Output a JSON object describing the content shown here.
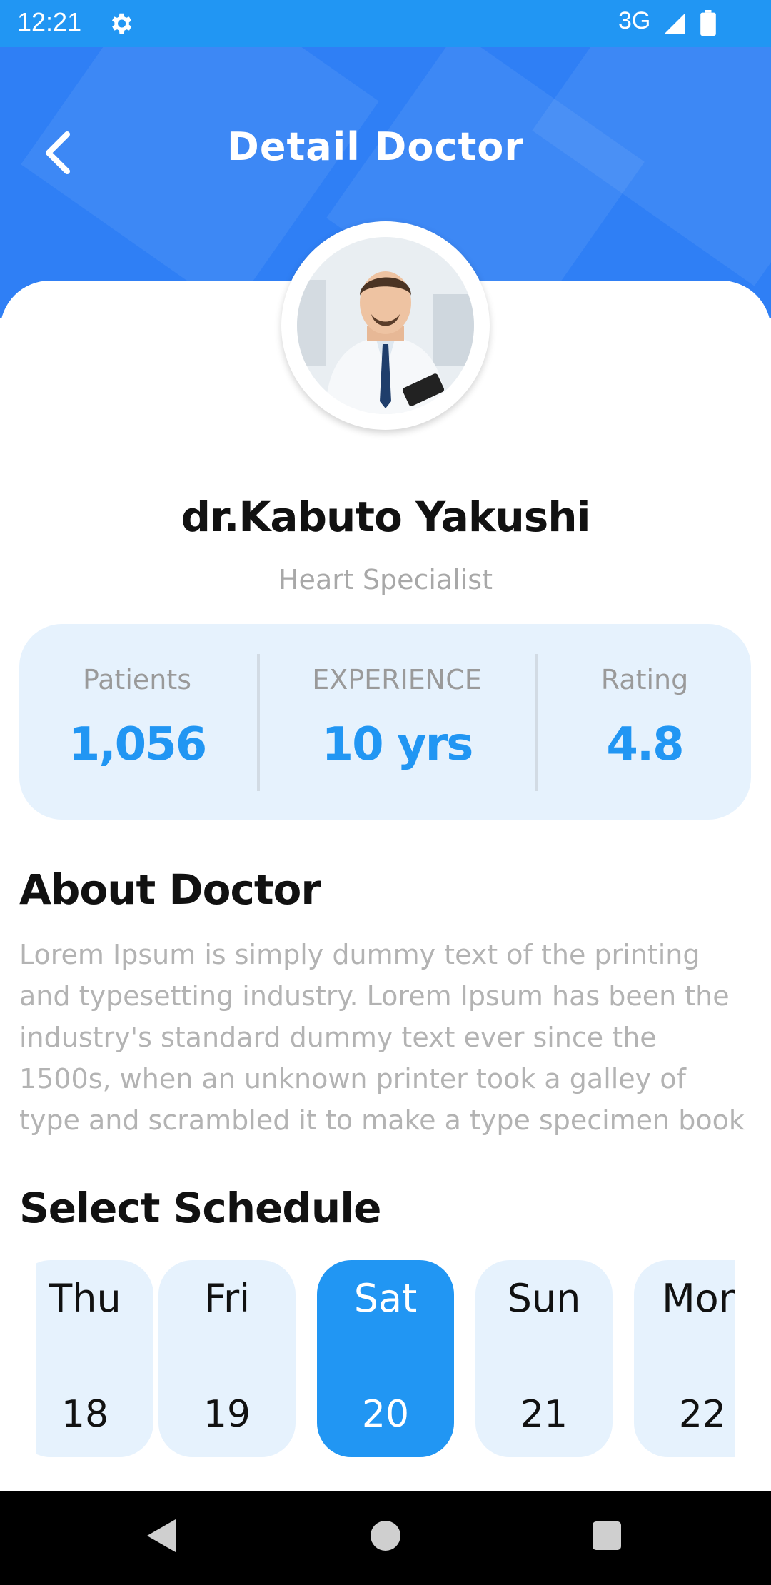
{
  "status_bar": {
    "time": "12:21",
    "network": "3G",
    "icons": [
      "gear-icon",
      "signal-icon",
      "battery-icon"
    ]
  },
  "header": {
    "title": "Detail Doctor",
    "back_icon": "chevron-left-icon",
    "color": "#2f7ff5"
  },
  "doctor": {
    "name": "dr.Kabuto Yakushi",
    "specialty": "Heart Specialist"
  },
  "stats": [
    {
      "label": "Patients",
      "value": "1,056"
    },
    {
      "label": "EXPERIENCE",
      "value": "10 yrs"
    },
    {
      "label": "Rating",
      "value": "4.8"
    }
  ],
  "about": {
    "title": "About Doctor",
    "text": "Lorem Ipsum is simply dummy text of the printing and typesetting industry. Lorem Ipsum has been the industry's standard dummy text ever since the 1500s, when an unknown printer took a galley of type and scrambled it to make a type specimen book"
  },
  "schedule": {
    "title": "Select Schedule",
    "days": [
      {
        "day": "Thu",
        "date": "18"
      },
      {
        "day": "Fri",
        "date": "19"
      },
      {
        "day": "Sat",
        "date": "20",
        "selected": true
      },
      {
        "day": "Sun",
        "date": "21"
      },
      {
        "day": "Mon",
        "date": "22"
      }
    ]
  },
  "colors": {
    "accent": "#2196F3",
    "stats_bg": "#e6f2fd",
    "muted_text": "#b3b3b3"
  },
  "nav_bar": {
    "icons": [
      "back-triangle-icon",
      "home-circle-icon",
      "recents-square-icon"
    ]
  }
}
